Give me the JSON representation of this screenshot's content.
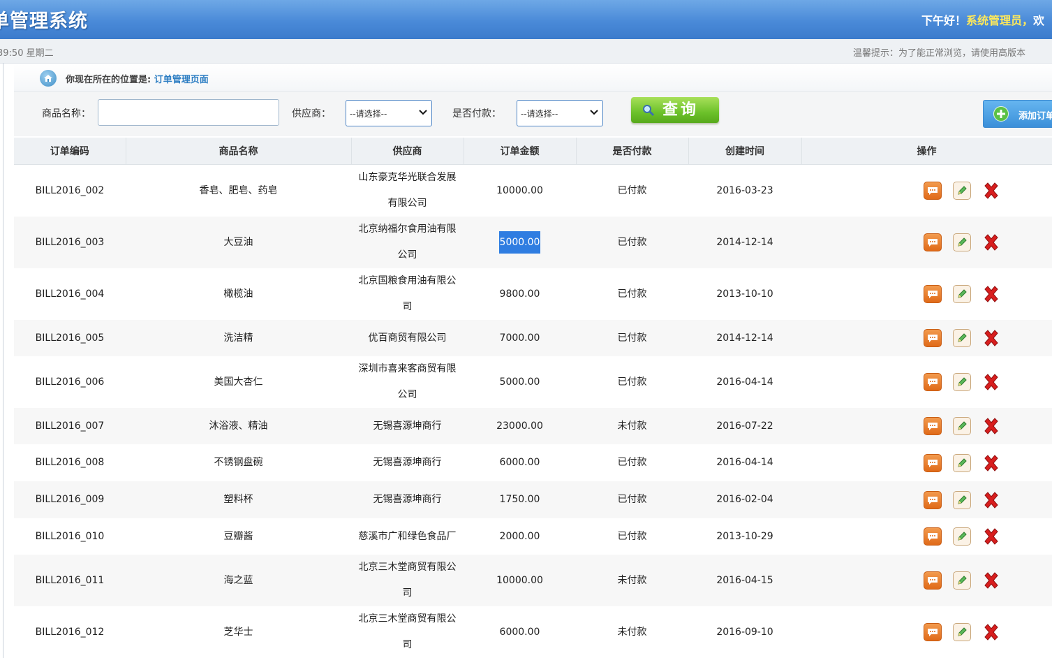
{
  "header": {
    "app_title": "单管理系统",
    "greeting": "下午好！",
    "admin_name": "系统管理员，",
    "welcome_tail": "欢"
  },
  "statusbar": {
    "clock": "39:50 星期二",
    "tip": "温馨提示：为了能正常浏览，请使用高版本"
  },
  "location": {
    "label": "你现在所在的位置是:",
    "page": "订单管理页面"
  },
  "search": {
    "product_label": "商品名称：",
    "product_value": "",
    "provider_label": "供应商：",
    "provider_selected": "--请选择--",
    "paid_label": "是否付款：",
    "paid_selected": "--请选择--",
    "query_button": "查询",
    "add_button": "添加订单"
  },
  "table": {
    "headers": [
      "订单编码",
      "商品名称",
      "供应商",
      "订单金额",
      "是否付款",
      "创建时间",
      "操作"
    ],
    "rows": [
      {
        "code": "BILL2016_002",
        "product": "香皂、肥皂、药皂",
        "provider": "山东豪克华光联合发展有限公司",
        "amount": "10000.00",
        "paid": "已付款",
        "created": "2016-03-23"
      },
      {
        "code": "BILL2016_003",
        "product": "大豆油",
        "provider": "北京纳福尔食用油有限公司",
        "amount": "5000.00",
        "paid": "已付款",
        "created": "2014-12-14"
      },
      {
        "code": "BILL2016_004",
        "product": "橄榄油",
        "provider": "北京国粮食用油有限公司",
        "amount": "9800.00",
        "paid": "已付款",
        "created": "2013-10-10"
      },
      {
        "code": "BILL2016_005",
        "product": "洗洁精",
        "provider": "优百商贸有限公司",
        "amount": "7000.00",
        "paid": "已付款",
        "created": "2014-12-14"
      },
      {
        "code": "BILL2016_006",
        "product": "美国大杏仁",
        "provider": "深圳市喜来客商贸有限公司",
        "amount": "5000.00",
        "paid": "已付款",
        "created": "2016-04-14"
      },
      {
        "code": "BILL2016_007",
        "product": "沐浴液、精油",
        "provider": "无锡喜源坤商行",
        "amount": "23000.00",
        "paid": "未付款",
        "created": "2016-07-22"
      },
      {
        "code": "BILL2016_008",
        "product": "不锈钢盘碗",
        "provider": "无锡喜源坤商行",
        "amount": "6000.00",
        "paid": "已付款",
        "created": "2016-04-14"
      },
      {
        "code": "BILL2016_009",
        "product": "塑料杯",
        "provider": "无锡喜源坤商行",
        "amount": "1750.00",
        "paid": "已付款",
        "created": "2016-02-04"
      },
      {
        "code": "BILL2016_010",
        "product": "豆瓣酱",
        "provider": "慈溪市广和绿色食品厂",
        "amount": "2000.00",
        "paid": "已付款",
        "created": "2013-10-29"
      },
      {
        "code": "BILL2016_011",
        "product": "海之蓝",
        "provider": "北京三木堂商贸有限公司",
        "amount": "10000.00",
        "paid": "未付款",
        "created": "2016-04-15"
      },
      {
        "code": "BILL2016_012",
        "product": "芝华士",
        "provider": "北京三木堂商贸有限公司",
        "amount": "6000.00",
        "paid": "未付款",
        "created": "2016-09-10"
      }
    ],
    "row_icons": [
      "view-icon",
      "edit-icon",
      "delete-icon"
    ]
  }
}
